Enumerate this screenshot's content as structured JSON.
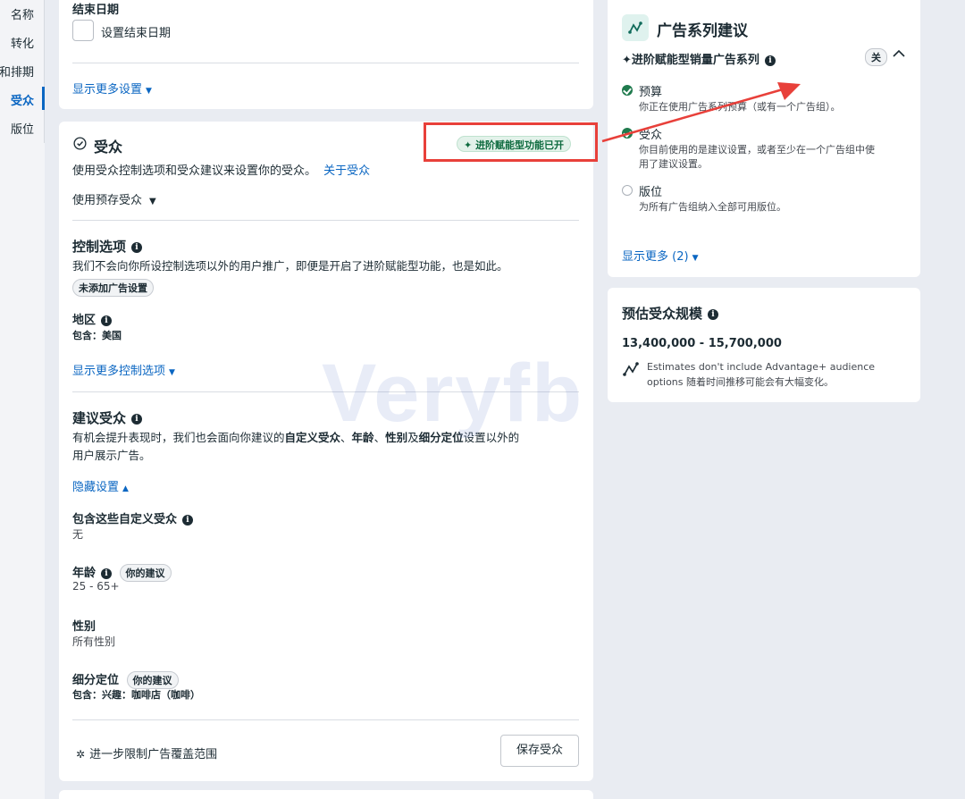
{
  "nav": {
    "items": [
      {
        "label": "名称"
      },
      {
        "label": "转化"
      },
      {
        "label": "和排期"
      },
      {
        "label": "受众"
      },
      {
        "label": "版位"
      }
    ]
  },
  "schedule": {
    "end_date_title": "结束日期",
    "set_end_date_label": "设置结束日期",
    "show_more_settings": "显示更多设置"
  },
  "audience": {
    "title": "受众",
    "advantage_badge": "进阶赋能型功能已开",
    "description": "使用受众控制选项和受众建议来设置你的受众。",
    "about_link": "关于受众",
    "saved_audience_dropdown": "使用预存受众",
    "controls": {
      "title": "控制选项",
      "description": "我们不会向你所设控制选项以外的用户推广，即便是开启了进阶赋能型功能，也是如此。",
      "no_ad_settings_pill": "未添加广告设置",
      "region_title": "地区",
      "region_value": "包含：美国",
      "show_more_controls": "显示更多控制选项"
    },
    "suggestion": {
      "title": "建议受众",
      "desc_part1": "有机会提升表现时，我们也会面向你建议的",
      "desc_bold1": "自定义受众",
      "desc_sep1": "、",
      "desc_bold2": "年龄",
      "desc_sep2": "、",
      "desc_bold3": "性别",
      "desc_sep3": "及",
      "desc_bold4": "细分定位",
      "desc_part2": "设置以外的",
      "desc_line2": "用户展示广告。",
      "hide_settings": "隐藏设置",
      "custom_audience_title": "包含这些自定义受众",
      "custom_audience_value": "无",
      "age_title": "年龄",
      "age_pill": "你的建议",
      "age_value": "25 - 65+",
      "gender_title": "性别",
      "gender_value": "所有性别",
      "detailed_title": "细分定位",
      "detailed_pill": "你的建议",
      "detailed_value": "包含：兴趣：咖啡店（咖啡）"
    },
    "limit_reach": "进一步限制广告覆盖范围",
    "save_button": "保存受众"
  },
  "recommendations": {
    "title": "广告系列建议",
    "subtitle": "✦进阶赋能型销量广告系列",
    "toggle_label": "关",
    "items": [
      {
        "title": "预算",
        "desc": "你正在使用广告系列预算（或有一个广告组）。",
        "done": true
      },
      {
        "title": "受众",
        "desc_line1": "你目前使用的是建议设置，或者至少在一个广告组中使",
        "desc_line2": "用了建议设置。",
        "done": true
      },
      {
        "title": "版位",
        "desc": "为所有广告组纳入全部可用版位。",
        "done": false
      }
    ],
    "show_more": "显示更多 (2)"
  },
  "audience_size": {
    "title": "预估受众规模",
    "range": "13,400,000 - 15,700,000",
    "note_line1": "Estimates don't include Advantage+ audience",
    "note_line2": "options 随着时间推移可能会有大幅变化。"
  },
  "watermark": "Veryfb",
  "colors": {
    "accent": "#0a66c2",
    "success": "#1f7a4d",
    "annotation_red": "#e8403a",
    "background": "#e9ecf2"
  },
  "icons": {
    "check_circle": "check-circle-icon",
    "info": "info-icon",
    "sparkle": "sparkle-icon",
    "gear": "gear-icon",
    "chevron_up": "chevron-up-icon",
    "caret_down": "caret-down-icon",
    "recommendation": "recommendation-icon"
  }
}
